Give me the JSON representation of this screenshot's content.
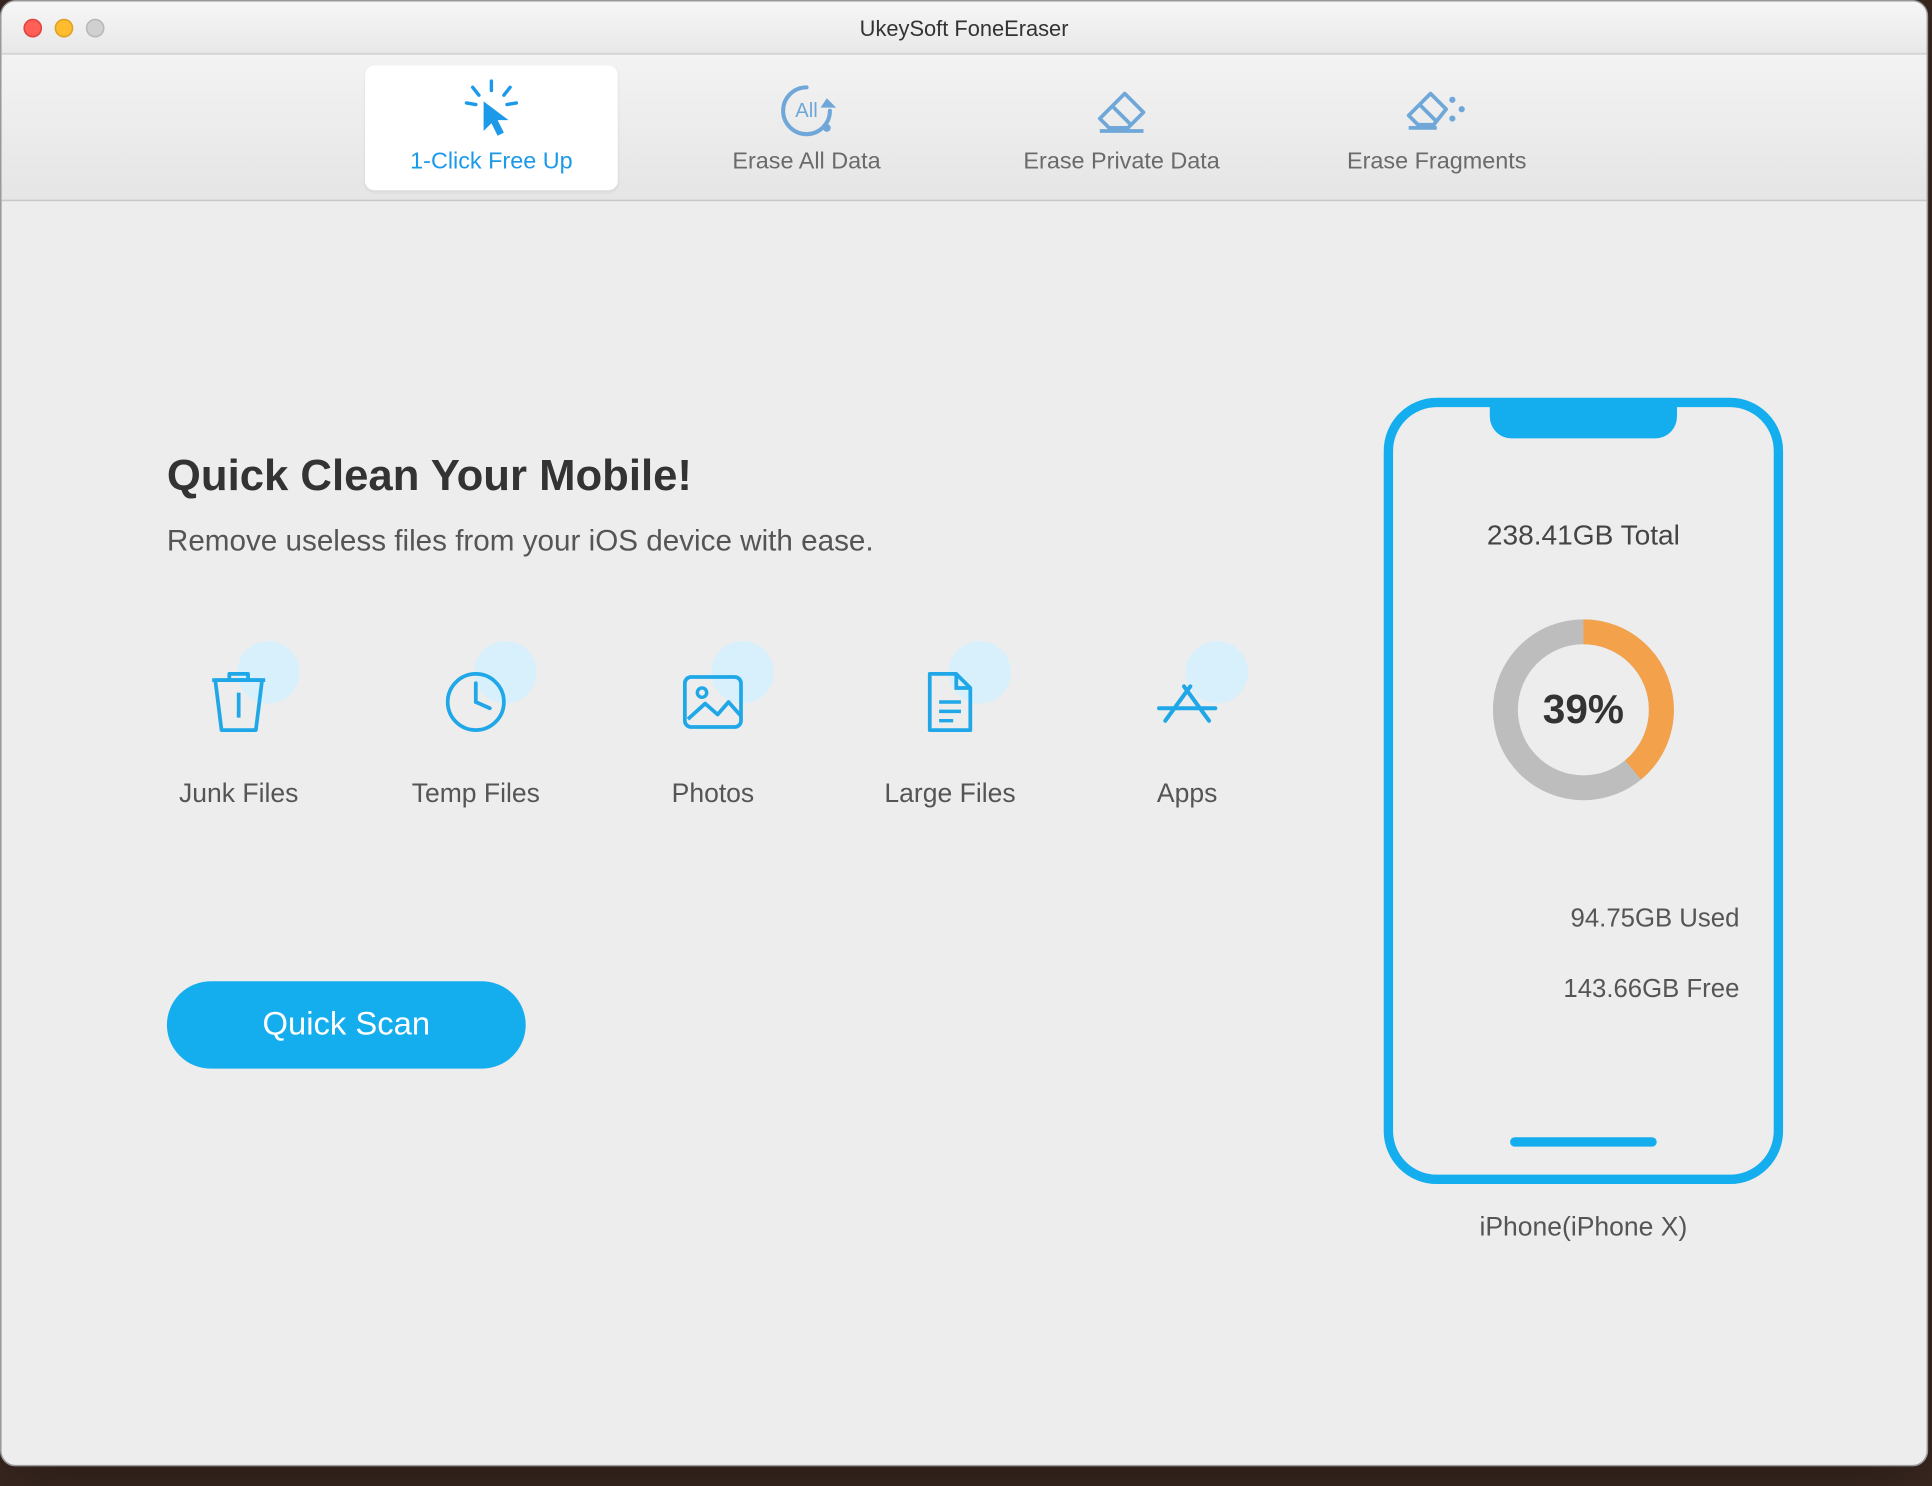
{
  "window": {
    "title": "UkeySoft FoneEraser"
  },
  "tabs": [
    {
      "label": "1-Click Free Up",
      "active": true
    },
    {
      "label": "Erase All Data",
      "active": false
    },
    {
      "label": "Erase Private Data",
      "active": false
    },
    {
      "label": "Erase Fragments",
      "active": false
    }
  ],
  "main": {
    "heading": "Quick Clean Your Mobile!",
    "subheading": "Remove useless files from your iOS device with ease.",
    "categories": [
      {
        "label": "Junk Files"
      },
      {
        "label": "Temp Files"
      },
      {
        "label": "Photos"
      },
      {
        "label": "Large Files"
      },
      {
        "label": "Apps"
      }
    ],
    "scan_button": "Quick Scan"
  },
  "device": {
    "total": "238.41GB Total",
    "used_pct_label": "39%",
    "used_pct": 39,
    "used": "94.75GB Used",
    "free": "143.66GB Free",
    "name": "iPhone(iPhone X)"
  },
  "chart_data": {
    "type": "pie",
    "title": "Storage Usage",
    "series": [
      {
        "name": "Used",
        "value": 94.75,
        "unit": "GB",
        "pct": 39,
        "color": "#f3a14b"
      },
      {
        "name": "Free",
        "value": 143.66,
        "unit": "GB",
        "pct": 61,
        "color": "#bdbdbd"
      }
    ],
    "total": {
      "value": 238.41,
      "unit": "GB"
    }
  },
  "colors": {
    "accent": "#14aeef",
    "donut_used": "#f3a14b",
    "donut_free": "#bdbdbd"
  }
}
